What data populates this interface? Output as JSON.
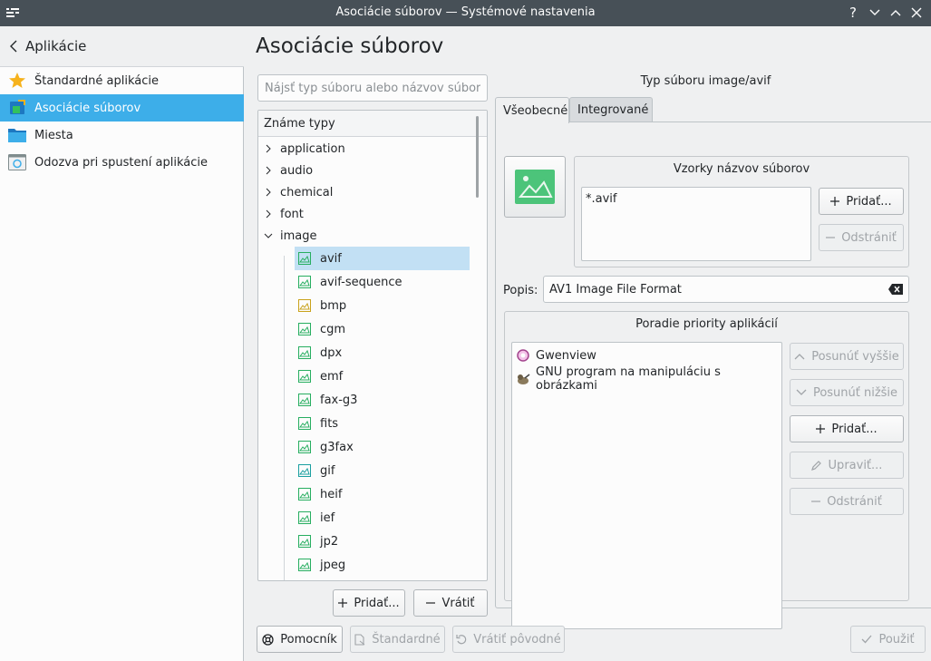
{
  "window": {
    "title": "Asociácie súborov — Systémové nastavenia",
    "help_glyph": "?"
  },
  "sidebar": {
    "back_label": "Aplikácie",
    "items": [
      {
        "label": "Štandardné aplikácie",
        "icon": "star-icon"
      },
      {
        "label": "Asociácie súborov",
        "icon": "file-association-icon"
      },
      {
        "label": "Miesta",
        "icon": "folder-icon"
      },
      {
        "label": "Odozva pri spustení aplikácie",
        "icon": "launch-feedback-icon"
      }
    ]
  },
  "main": {
    "title": "Asociácie súborov",
    "search_placeholder": "Nájsť typ súboru alebo názvov súboru...",
    "tree_header": "Známe typy",
    "groups": [
      "application",
      "audio",
      "chemical",
      "font",
      "image"
    ],
    "image_children": [
      "avif",
      "avif-sequence",
      "bmp",
      "cgm",
      "dpx",
      "emf",
      "fax-g3",
      "fits",
      "g3fax",
      "gif",
      "heif",
      "ief",
      "jp2",
      "jpeg"
    ],
    "add_label": "Pridať...",
    "revert_label": "Vrátiť"
  },
  "details": {
    "heading": "Typ súboru image/avif",
    "tab_general": "Všeobecné",
    "tab_embedded": "Integrované",
    "patterns_title": "Vzorky názvov súborov",
    "patterns": [
      "*.avif"
    ],
    "pattern_add": "Pridať...",
    "pattern_remove": "Odstrániť",
    "description_label": "Popis:",
    "description_value": "AV1 Image File Format",
    "priority_title": "Poradie priority aplikácií",
    "apps": [
      "Gwenview",
      "GNU program na manipuláciu s obrázkami"
    ],
    "move_up": "Posunúť vyššie",
    "move_down": "Posunúť nižšie",
    "app_add": "Pridať...",
    "app_edit": "Upraviť...",
    "app_remove": "Odstrániť"
  },
  "footer": {
    "help": "Pomocník",
    "defaults": "Štandardné",
    "reset": "Vrátiť pôvodné",
    "apply": "Použiť"
  },
  "colors": {
    "accent": "#3daee9",
    "selection": "#c2e0f4",
    "titlebar": "#475057"
  }
}
